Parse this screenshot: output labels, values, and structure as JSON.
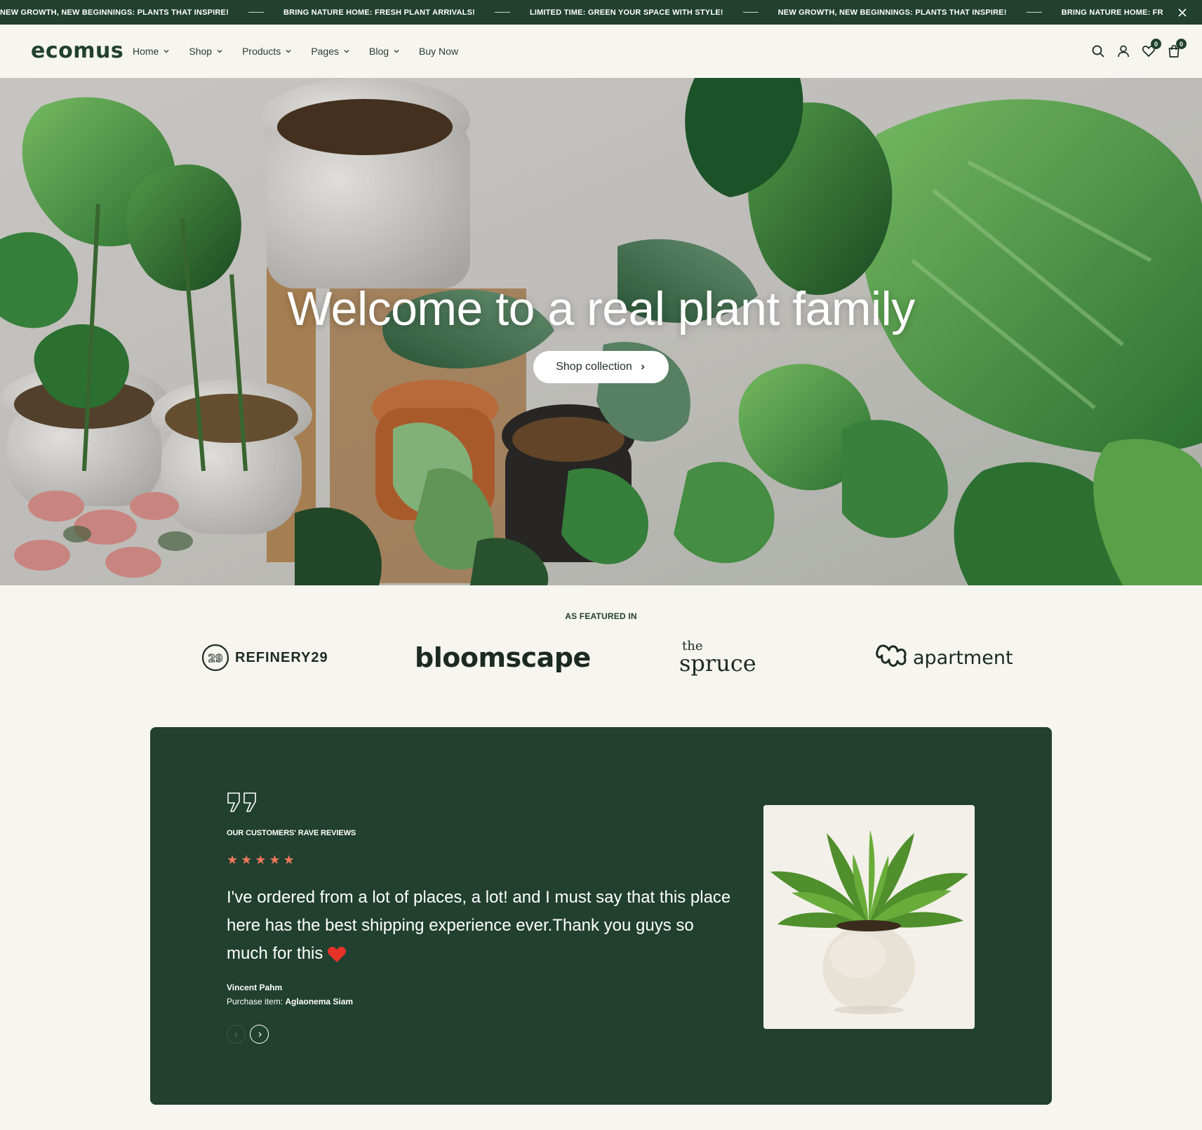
{
  "announcement": {
    "messages": [
      "NEW GROWTH, NEW BEGINNINGS: PLANTS THAT INSPIRE!",
      "BRING NATURE HOME: FRESH PLANT ARRIVALS!",
      "LIMITED TIME: GREEN YOUR SPACE WITH STYLE!",
      "NEW GROWTH, NEW BEGINNINGS: PLANTS THAT INSPIRE!",
      "BRING NATURE HOME: FRESH PLANT ARRIVALS!"
    ],
    "close_icon": "close-icon"
  },
  "header": {
    "logo": "ecomus",
    "nav": [
      {
        "label": "Home",
        "has_dropdown": true
      },
      {
        "label": "Shop",
        "has_dropdown": true
      },
      {
        "label": "Products",
        "has_dropdown": true
      },
      {
        "label": "Pages",
        "has_dropdown": true
      },
      {
        "label": "Blog",
        "has_dropdown": true
      },
      {
        "label": "Buy Now",
        "has_dropdown": false
      }
    ],
    "icons": [
      "search-icon",
      "user-icon",
      "heart-icon",
      "cart-icon"
    ],
    "wishlist_count": "0",
    "cart_count": "0"
  },
  "hero": {
    "title": "Welcome to a real plant family",
    "button_label": "Shop collection"
  },
  "featured": {
    "label": "AS FEATURED IN",
    "brands": {
      "refinery": "REFINERY29",
      "bloomscape": "bloomscape",
      "spruce_the": "the",
      "spruce_main": "spruce",
      "apartment": "apartment"
    }
  },
  "review": {
    "eyebrow": "OUR CUSTOMERS' RAVE REVIEWS",
    "rating": 5,
    "text": "I've ordered from a lot of places, a lot! and I must say that this place here has the best shipping experience ever.Thank you guys so much for this",
    "reviewer": "Vincent Pahm",
    "purchase_label": "Purchase item:",
    "purchase_item": "Aglaonema Siam"
  },
  "colors": {
    "brand_dark": "#21402f",
    "background": "#f6f5f0",
    "star": "#f2775a",
    "heart": "#e5332a"
  }
}
